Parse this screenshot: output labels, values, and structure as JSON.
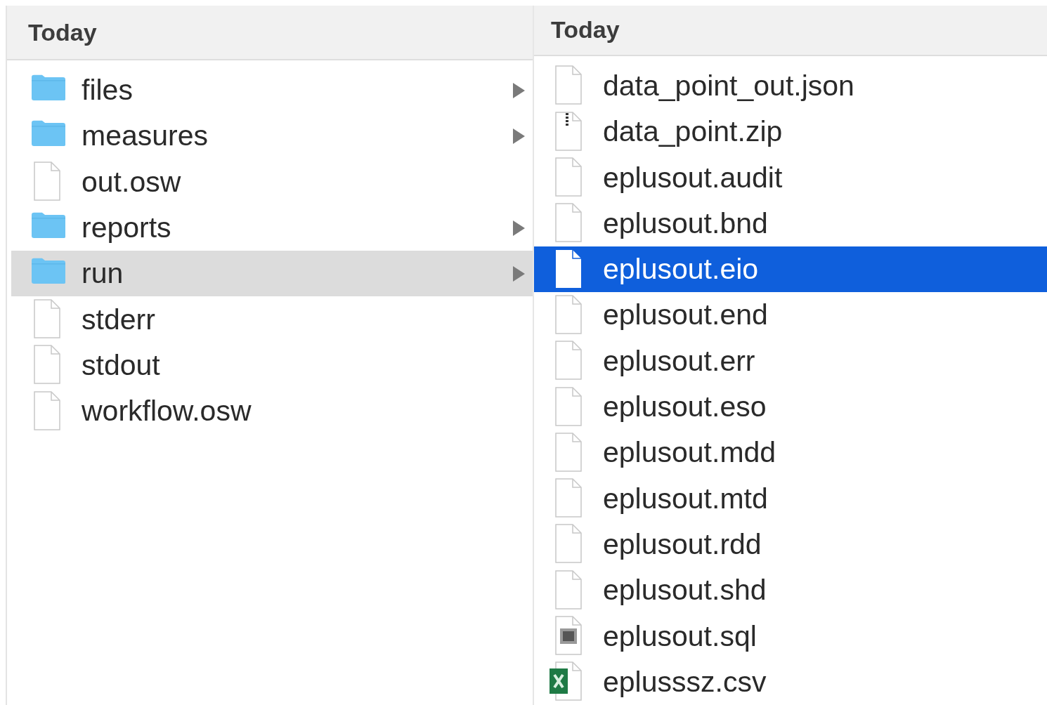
{
  "columns": [
    {
      "header": "Today",
      "items": [
        {
          "name": "files",
          "kind": "folder",
          "selected": false
        },
        {
          "name": "measures",
          "kind": "folder",
          "selected": false
        },
        {
          "name": "out.osw",
          "kind": "file",
          "selected": false
        },
        {
          "name": "reports",
          "kind": "folder",
          "selected": false
        },
        {
          "name": "run",
          "kind": "folder",
          "selected": true
        },
        {
          "name": "stderr",
          "kind": "file",
          "selected": false
        },
        {
          "name": "stdout",
          "kind": "file",
          "selected": false
        },
        {
          "name": "workflow.osw",
          "kind": "file",
          "selected": false
        }
      ]
    },
    {
      "header": "Today",
      "items": [
        {
          "name": "data_point_out.json",
          "kind": "file",
          "selected": false
        },
        {
          "name": "data_point.zip",
          "kind": "zip",
          "selected": false
        },
        {
          "name": "eplusout.audit",
          "kind": "file",
          "selected": false
        },
        {
          "name": "eplusout.bnd",
          "kind": "file",
          "selected": false
        },
        {
          "name": "eplusout.eio",
          "kind": "file",
          "selected": true
        },
        {
          "name": "eplusout.end",
          "kind": "file",
          "selected": false
        },
        {
          "name": "eplusout.err",
          "kind": "file",
          "selected": false
        },
        {
          "name": "eplusout.eso",
          "kind": "file",
          "selected": false
        },
        {
          "name": "eplusout.mdd",
          "kind": "file",
          "selected": false
        },
        {
          "name": "eplusout.mtd",
          "kind": "file",
          "selected": false
        },
        {
          "name": "eplusout.rdd",
          "kind": "file",
          "selected": false
        },
        {
          "name": "eplusout.shd",
          "kind": "file",
          "selected": false
        },
        {
          "name": "eplusout.sql",
          "kind": "sql",
          "selected": false
        },
        {
          "name": "eplusssz.csv",
          "kind": "excel",
          "selected": false
        }
      ]
    }
  ]
}
